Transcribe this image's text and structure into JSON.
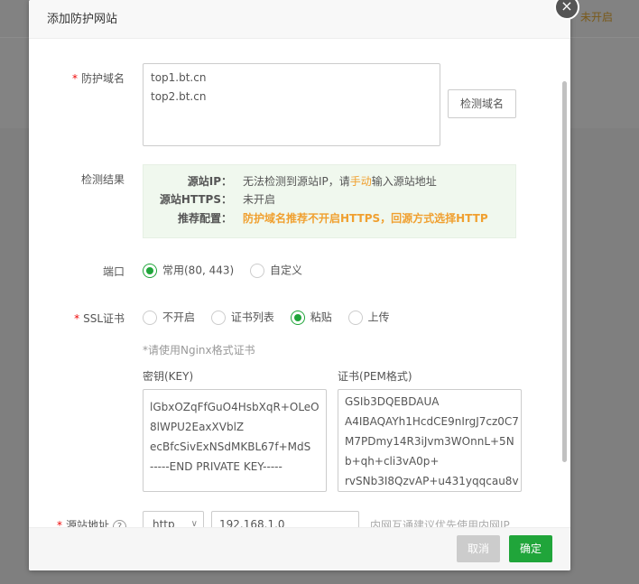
{
  "background": {
    "status_text": "未开启"
  },
  "dialog": {
    "title": "添加防护网站",
    "close_icon": "×",
    "domain": {
      "label": "防护域名",
      "required_mark": "*",
      "lines": [
        "top1.bt.cn",
        "top2.bt.cn"
      ],
      "detect_button": "检测域名"
    },
    "result": {
      "label": "检测结果",
      "source_ip_key": "源站IP：",
      "source_ip_prefix": "无法检测到源站IP，请",
      "source_ip_link": "手动",
      "source_ip_suffix": "输入源站地址",
      "https_key": "源站HTTPS：",
      "https_value": "未开启",
      "recommend_key": "推荐配置：",
      "recommend_value": "防护域名推荐不开启HTTPS，回源方式选择HTTP"
    },
    "port": {
      "label": "端口",
      "options": [
        "常用(80, 443)",
        "自定义"
      ],
      "selected": "常用(80, 443)"
    },
    "ssl": {
      "label": "SSL证书",
      "required_mark": "*",
      "options": [
        "不开启",
        "证书列表",
        "粘贴",
        "上传"
      ],
      "selected": "粘贴",
      "hint": "*请使用Nginx格式证书",
      "key_label": "密钥(KEY)",
      "key_lines": [
        "lGbxOZqFfGuO4HsbXqR+OLeO",
        "8lWPU2EaxXVblZ",
        "ecBfcSivExNSdMKBL67f+MdS",
        "-----END PRIVATE KEY-----"
      ],
      "pem_label": "证书(PEM格式)",
      "pem_lines": [
        "GSIb3DQEBDAUA",
        "A4IBAQAYh1HcdCE9nIrgJ7cz0C7",
        "M7PDmy14R3iJvm3WOnnL+5N",
        "b+qh+cli3vA0p+",
        "rvSNb3I8QzvAP+u431yqqcau8v"
      ]
    },
    "source": {
      "label": "源站地址",
      "required_mark": "*",
      "protocol": "http",
      "ip_value": "192.168.1.0",
      "hint": "内网互通建议优先使用内网IP"
    },
    "footer": {
      "cancel": "取消",
      "confirm": "确定"
    }
  }
}
